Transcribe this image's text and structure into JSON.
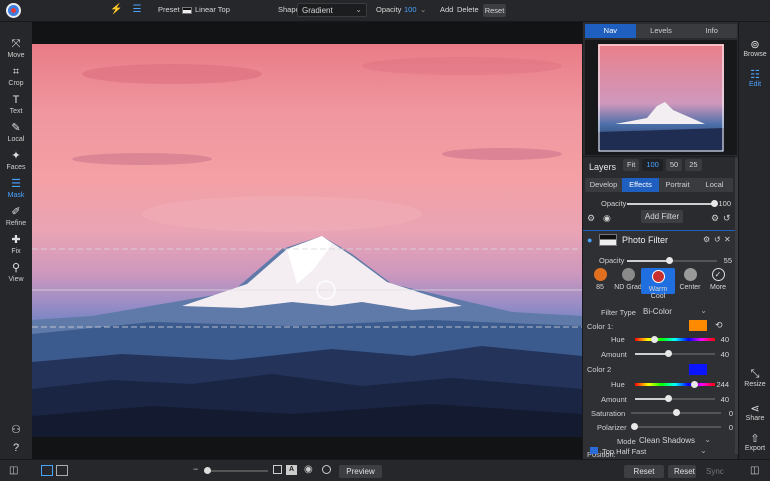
{
  "toolbar": {
    "preset_label": "Preset",
    "preset_value": "Linear Top",
    "shape_label": "Shape",
    "shape_value": "Gradient",
    "opacity_label": "Opacity",
    "opacity_value": "100",
    "add": "Add",
    "delete": "Delete",
    "reset": "Reset"
  },
  "left_tools": [
    {
      "label": "Move",
      "icon": "move-icon",
      "glyph": "⤧"
    },
    {
      "label": "Crop",
      "icon": "crop-icon",
      "glyph": "⌗"
    },
    {
      "label": "Text",
      "icon": "text-icon",
      "glyph": "T"
    },
    {
      "label": "Local",
      "icon": "brush-icon",
      "glyph": "✎"
    },
    {
      "label": "Faces",
      "icon": "wand-icon",
      "glyph": "✦"
    },
    {
      "label": "Mask",
      "icon": "mask-icon",
      "glyph": "☰"
    },
    {
      "label": "Refine",
      "icon": "refine-brush-icon",
      "glyph": "✐"
    },
    {
      "label": "Fix",
      "icon": "fix-icon",
      "glyph": "✚"
    },
    {
      "label": "View",
      "icon": "search-icon",
      "glyph": "⚲"
    }
  ],
  "nav": {
    "tabs": [
      "Nav",
      "Levels",
      "Info"
    ],
    "zoom": [
      "Fit",
      "100",
      "50",
      "25"
    ]
  },
  "layers": {
    "title": "Layers",
    "tabs": [
      "Develop",
      "Effects",
      "Portrait",
      "Local"
    ],
    "opacity_label": "Opacity",
    "opacity_value": "100",
    "add_filter": "Add Filter"
  },
  "filter": {
    "name": "Photo Filter",
    "opacity_label": "Opacity",
    "opacity_value": "55",
    "presets": [
      "85",
      "ND Grad",
      "Warm Cool",
      "Center",
      "More"
    ],
    "filter_type_label": "Filter Type",
    "filter_type_value": "Bi-Color",
    "color1_label": "Color 1:",
    "color1_hex": "#ff8a00",
    "color1_hue_label": "Hue",
    "color1_hue_value": "40",
    "color1_amount_label": "Amount",
    "color1_amount_value": "40",
    "color2_label": "Color 2",
    "color2_hex": "#0a14ff",
    "color2_hue_label": "Hue",
    "color2_hue_value": "244",
    "color2_amount_label": "Amount",
    "color2_amount_value": "40",
    "saturation_label": "Saturation",
    "saturation_value": "0",
    "polarizer_label": "Polarizer",
    "polarizer_value": "0",
    "mode_label": "Mode",
    "mode_value": "Clean Shadows",
    "position_label": "Position:",
    "position_value": "Top Half Fast"
  },
  "right_rail": [
    {
      "label": "Browse",
      "icon": "browse-icon"
    },
    {
      "label": "Edit",
      "icon": "sliders-icon"
    },
    {
      "label": "Resize",
      "icon": "resize-icon"
    },
    {
      "label": "Share",
      "icon": "share-icon"
    },
    {
      "label": "Export",
      "icon": "export-icon"
    }
  ],
  "bottom": {
    "preview": "Preview",
    "reset_all": "Reset All",
    "reset": "Reset",
    "sync": "Sync"
  }
}
